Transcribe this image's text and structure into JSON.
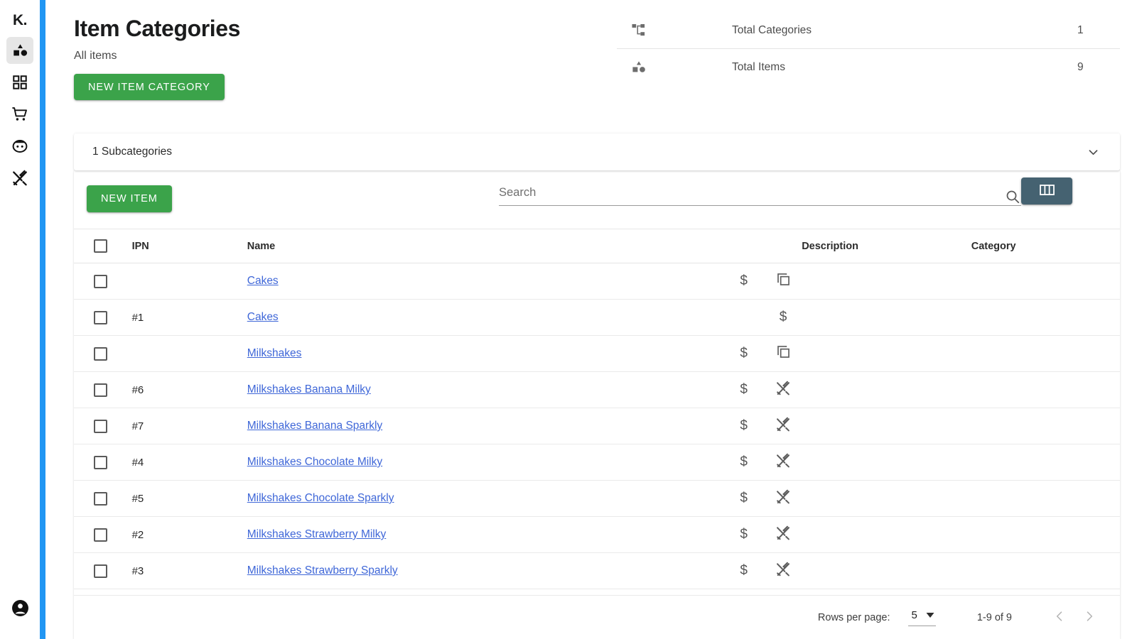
{
  "app": {
    "brand": "K."
  },
  "sidebar": {
    "items": [
      {
        "icon": "shapes-icon",
        "name": "sidebar-item-parts",
        "active": true
      },
      {
        "icon": "grid-icon",
        "name": "sidebar-item-stock",
        "active": false
      },
      {
        "icon": "cart-icon",
        "name": "sidebar-item-purchasing",
        "active": false
      },
      {
        "icon": "customer-icon",
        "name": "sidebar-item-sales",
        "active": false
      },
      {
        "icon": "tools-icon",
        "name": "sidebar-item-build",
        "active": false
      }
    ],
    "account": {
      "icon": "account-circle-icon",
      "name": "sidebar-account"
    }
  },
  "header": {
    "title": "Item Categories",
    "subtitle": "All items",
    "new_category_label": "NEW ITEM CATEGORY"
  },
  "stats": [
    {
      "icon": "sitemap-icon",
      "label": "Total Categories",
      "value": "1"
    },
    {
      "icon": "shapes-icon",
      "label": "Total Items",
      "value": "9"
    }
  ],
  "subcategories": {
    "label": "1 Subcategories",
    "chevron": "chevron-down-icon"
  },
  "toolbar": {
    "new_item_label": "NEW ITEM",
    "search_placeholder": "Search",
    "search_value": "",
    "search_icon": "search-icon",
    "columns_icon": "columns-icon"
  },
  "table": {
    "columns": [
      "",
      "IPN",
      "Name",
      "",
      "",
      "Description",
      "Category"
    ],
    "rows": [
      {
        "ipn": "",
        "name": "Cakes",
        "icon1": "dollar-icon",
        "icon2": "copy-icon",
        "description": "",
        "category": ""
      },
      {
        "ipn": "#1",
        "name": "Cakes",
        "icon1": "",
        "icon2": "dollar-icon",
        "description": "",
        "category": ""
      },
      {
        "ipn": "",
        "name": "Milkshakes",
        "icon1": "dollar-icon",
        "icon2": "copy-icon",
        "description": "",
        "category": ""
      },
      {
        "ipn": "#6",
        "name": "Milkshakes Banana Milky",
        "icon1": "dollar-icon",
        "icon2": "tools-icon",
        "description": "",
        "category": ""
      },
      {
        "ipn": "#7",
        "name": "Milkshakes Banana Sparkly",
        "icon1": "dollar-icon",
        "icon2": "tools-icon",
        "description": "",
        "category": ""
      },
      {
        "ipn": "#4",
        "name": "Milkshakes Chocolate Milky",
        "icon1": "dollar-icon",
        "icon2": "tools-icon",
        "description": "",
        "category": ""
      },
      {
        "ipn": "#5",
        "name": "Milkshakes Chocolate Sparkly",
        "icon1": "dollar-icon",
        "icon2": "tools-icon",
        "description": "",
        "category": ""
      },
      {
        "ipn": "#2",
        "name": "Milkshakes Strawberry Milky",
        "icon1": "dollar-icon",
        "icon2": "tools-icon",
        "description": "",
        "category": ""
      },
      {
        "ipn": "#3",
        "name": "Milkshakes Strawberry Sparkly",
        "icon1": "dollar-icon",
        "icon2": "tools-icon",
        "description": "",
        "category": ""
      }
    ]
  },
  "pagination": {
    "rows_per_page_label": "Rows per page:",
    "rows_per_page_value": "5",
    "range_label": "1-9 of 9",
    "prev_icon": "chevron-left-icon",
    "next_icon": "chevron-right-icon"
  },
  "colors": {
    "accent_blue": "#2196f3",
    "primary_green": "#3ba34a",
    "columns_button": "#456271",
    "link_blue": "#3f67d8"
  }
}
